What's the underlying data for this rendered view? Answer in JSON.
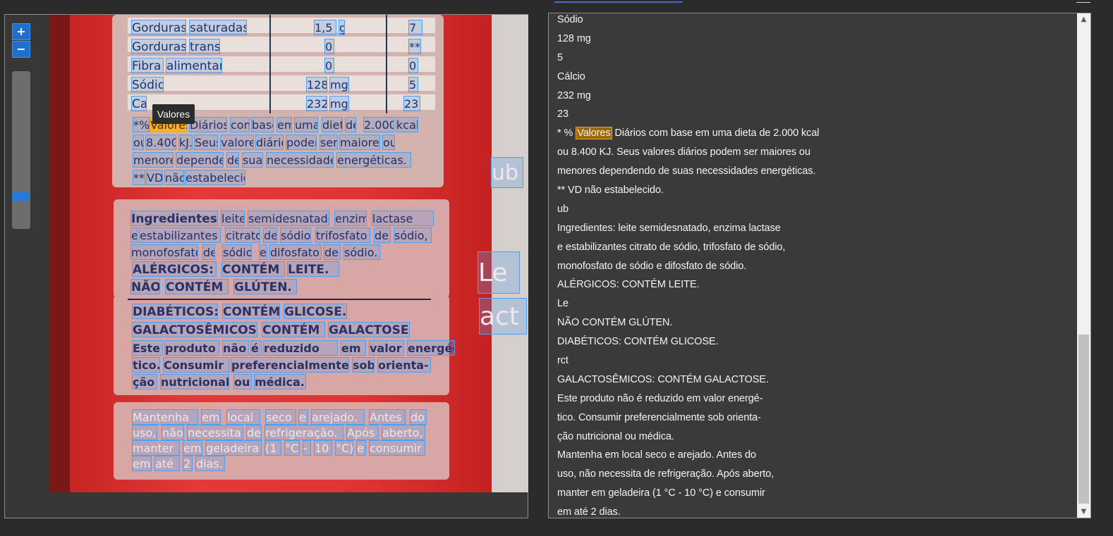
{
  "toolbar": {
    "zoom_in_label": "+",
    "zoom_out_label": "−"
  },
  "tooltip": {
    "text": "Valores"
  },
  "ocr_words": [
    "Gorduras",
    "saturadas",
    "1,5",
    "g",
    "7",
    "Gorduras",
    "trans",
    "0",
    "**",
    "Fibra",
    "alimentar",
    "0",
    "0",
    "Sódio",
    "128",
    "mg",
    "5",
    "Ca",
    "232",
    "mg",
    "23",
    "*%",
    "Valores",
    "Diários",
    "com",
    "base",
    "em",
    "uma",
    "dieta",
    "de",
    "2.000",
    "kcal",
    "ou",
    "8.400",
    "kJ.",
    "Seus",
    "valores",
    "diários",
    "podem",
    "ser",
    "maiores",
    "ou",
    "menores",
    "dependendo",
    "de",
    "suas",
    "necessidades",
    "energéticas.",
    "**",
    "VD",
    "não",
    "estabelecido.",
    "Ingredientes:",
    "leite",
    "semidesnatado,",
    "enzima",
    "lactase",
    "e",
    "estabilizantes",
    "citrato",
    "de",
    "sódio,",
    "trifosfato",
    "de",
    "sódio,",
    "monofosfato",
    "de",
    "sódio",
    "e",
    "difosfato",
    "de",
    "sódio.",
    "ALÉRGICOS:",
    "CONTÉM",
    "LEITE.",
    "NÃO",
    "CONTÉM",
    "GLÚTEN.",
    "DIABÉTICOS:",
    "CONTÉM",
    "GLICOSE.",
    "GALACTOSÊMICOS:",
    "CONTÉM",
    "GALACTOSE.",
    "Este",
    "produto",
    "não",
    "é",
    "reduzido",
    "em",
    "valor",
    "energé-",
    "tico.",
    "Consumir",
    "preferencialmente",
    "sob",
    "orienta-",
    "ção",
    "nutricional",
    "ou",
    "médica.",
    "Mantenha",
    "em",
    "local",
    "seco",
    "e",
    "arejado.",
    "Antes",
    "do",
    "uso,",
    "não",
    "necessita",
    "de",
    "refrigeração.",
    "Após",
    "aberto,",
    "manter",
    "em",
    "geladeira",
    "(1",
    "°C",
    "-",
    "10",
    "°C)",
    "e",
    "consumir",
    "em",
    "até",
    "2",
    "dias.",
    "ub",
    "Le",
    "act"
  ],
  "text_lines": [
    "Sódio",
    "128 mg",
    "5",
    "Cálcio",
    "232 mg",
    "23",
    "* % Valores Diários com base em uma dieta de 2.000 kcal",
    "ou 8.400 KJ. Seus valores diários podem ser maiores ou",
    "menores dependendo de suas necessidades energéticas.",
    "** VD não estabelecido.",
    "ub",
    "Ingredientes: leite semidesnatado, enzima lactase",
    "e estabilizantes citrato de sódio, trifosfato de sódio,",
    "monofosfato de sódio e difosfato de sódio.",
    "ALÉRGICOS: CONTÉM LEITE.",
    "Le",
    "NÃO CONTÉM GLÚTEN.",
    "DIABÉTICOS: CONTÉM GLICOSE.",
    "rct",
    "GALACTOSÊMICOS: CONTÉM GALACTOSE.",
    "Este produto não é reduzido em valor energé-",
    "tico. Consumir preferencialmente sob orienta-",
    "ção nutricional ou médica.",
    "Mantenha em local seco e arejado. Antes do",
    "uso, não necessita de refrigeração. Após aberto,",
    "manter em geladeira (1 °C - 10 °C) e consumir",
    "em até 2 dias."
  ],
  "highlight": {
    "line_index": 6,
    "before": "* % ",
    "word": "Valores",
    "after": " Diários com base em uma dieta de 2.000 kcal"
  },
  "scrollbar": {
    "up_glyph": "▲",
    "down_glyph": "▼"
  },
  "colors": {
    "highlight": "#f3a51b",
    "ocr_box": "#4d9ef5",
    "zoom_button": "#1f70cc"
  }
}
